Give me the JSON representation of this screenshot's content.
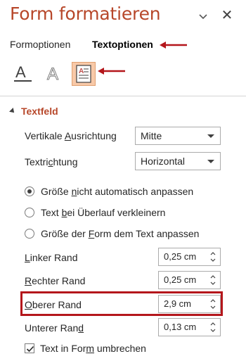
{
  "pane": {
    "title": "Form formatieren",
    "close_glyph": "✕"
  },
  "tabs": [
    {
      "label": "Formoptionen",
      "active": false
    },
    {
      "label": "Textoptionen",
      "active": true
    }
  ],
  "icons": [
    {
      "name": "text-fill-outline-icon",
      "selected": false
    },
    {
      "name": "text-effects-icon",
      "selected": false
    },
    {
      "name": "textbox-icon",
      "selected": true
    }
  ],
  "section": {
    "title": "Textfeld"
  },
  "vertical_alignment": {
    "label_pre": "Vertikale ",
    "label_ul": "A",
    "label_post": "usrichtung",
    "value": "Mitte"
  },
  "text_direction": {
    "label_pre": "Textri",
    "label_ul": "c",
    "label_post": "htung",
    "value": "Horizontal"
  },
  "autofit_options": [
    {
      "pre": "Größe ",
      "ul": "n",
      "post": "icht automatisch anpassen",
      "selected": true
    },
    {
      "pre": "Text ",
      "ul": "b",
      "post": "ei Überlauf verkleinern",
      "selected": false
    },
    {
      "pre": "Größe der ",
      "ul": "F",
      "post": "orm dem Text anpassen",
      "selected": false
    }
  ],
  "margins": [
    {
      "pre": "",
      "ul": "L",
      "post": "inker Rand",
      "value": "0,25 cm"
    },
    {
      "pre": "",
      "ul": "R",
      "post": "echter Rand",
      "value": "0,25 cm"
    },
    {
      "pre": "",
      "ul": "O",
      "post": "berer Rand",
      "value": "2,9 cm"
    },
    {
      "pre": "Unterer Ran",
      "ul": "d",
      "post": "",
      "value": "0,13 cm"
    }
  ],
  "wrap_text": {
    "pre": "Text in For",
    "ul": "m",
    "post": " umbrechen",
    "checked": true
  },
  "colors": {
    "accent": "#b7472a",
    "annotation_red": "#b4161b",
    "selected_icon_bg": "#f8c9a8"
  }
}
